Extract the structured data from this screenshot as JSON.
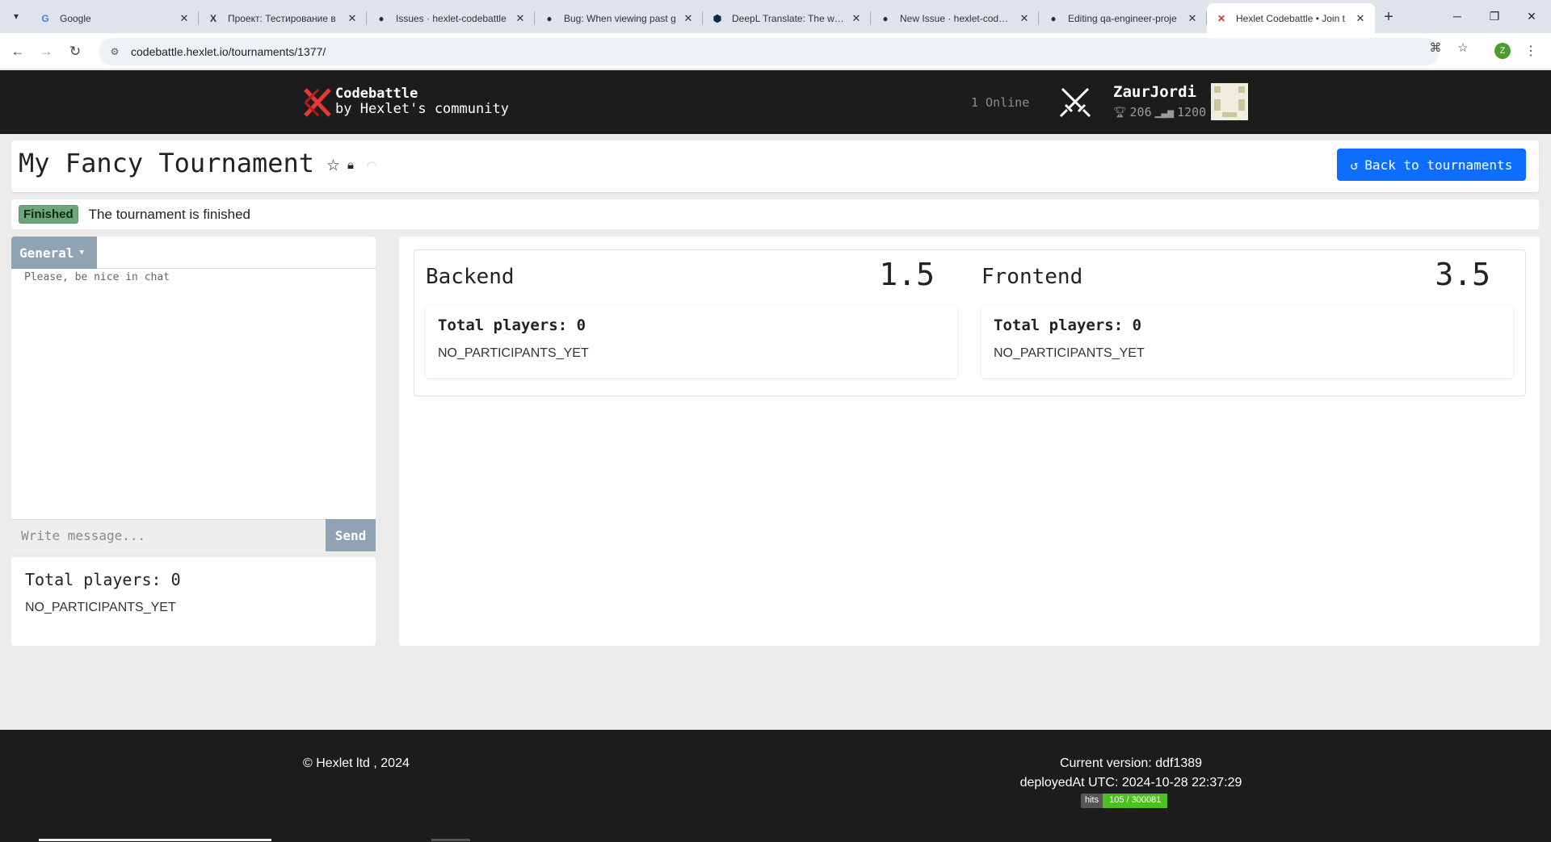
{
  "browser": {
    "tabs": [
      {
        "title": "Google",
        "icon": "google-icon"
      },
      {
        "title": "Проект: Тестирование в",
        "icon": "hexlet-icon"
      },
      {
        "title": "Issues · hexlet-codebattle",
        "icon": "github-icon"
      },
      {
        "title": "Bug: When viewing past g",
        "icon": "github-icon"
      },
      {
        "title": "DeepL Translate: The worl",
        "icon": "deepl-icon"
      },
      {
        "title": "New Issue · hexlet-codeba",
        "icon": "github-icon"
      },
      {
        "title": "Editing qa-engineer-proje",
        "icon": "github-icon"
      },
      {
        "title": "Hexlet Codebattle • Join t",
        "icon": "codebattle-icon"
      }
    ],
    "url": "codebattle.hexlet.io/tournaments/1377/",
    "profile_initial": "Z"
  },
  "header": {
    "logo_line1": "Codebattle",
    "logo_line2": "by Hexlet's community",
    "online": "1 Online",
    "user": {
      "name": "ZaurJordi",
      "trophies": "206",
      "rating": "1200"
    }
  },
  "tournament": {
    "title": "My Fancy Tournament",
    "back_label": "Back to tournaments",
    "status_badge": "Finished",
    "status_text": "The tournament is finished"
  },
  "chat": {
    "room": "General",
    "notice": "Please, be nice in chat",
    "placeholder": "Write message...",
    "send_label": "Send"
  },
  "players": {
    "title": "Total players: 0",
    "note": "NO_PARTICIPANTS_YET"
  },
  "teams": [
    {
      "name": "Backend",
      "score": "1.5",
      "players_title": "Total players: 0",
      "note": "NO_PARTICIPANTS_YET"
    },
    {
      "name": "Frontend",
      "score": "3.5",
      "players_title": "Total players: 0",
      "note": "NO_PARTICIPANTS_YET"
    }
  ],
  "footer": {
    "copyright": "© Hexlet ltd , 2024",
    "version": "Current version: ddf1389",
    "deployed": "deployedAt UTC: 2024-10-28 22:37:29",
    "hits_label": "hits",
    "hits_value": "105 / 300081"
  },
  "colors": {
    "accent": "#0d6efd",
    "header_bg": "#1c1c1c",
    "badge_finished": "#6fa77b",
    "chat_accent": "#8fa3b4"
  }
}
